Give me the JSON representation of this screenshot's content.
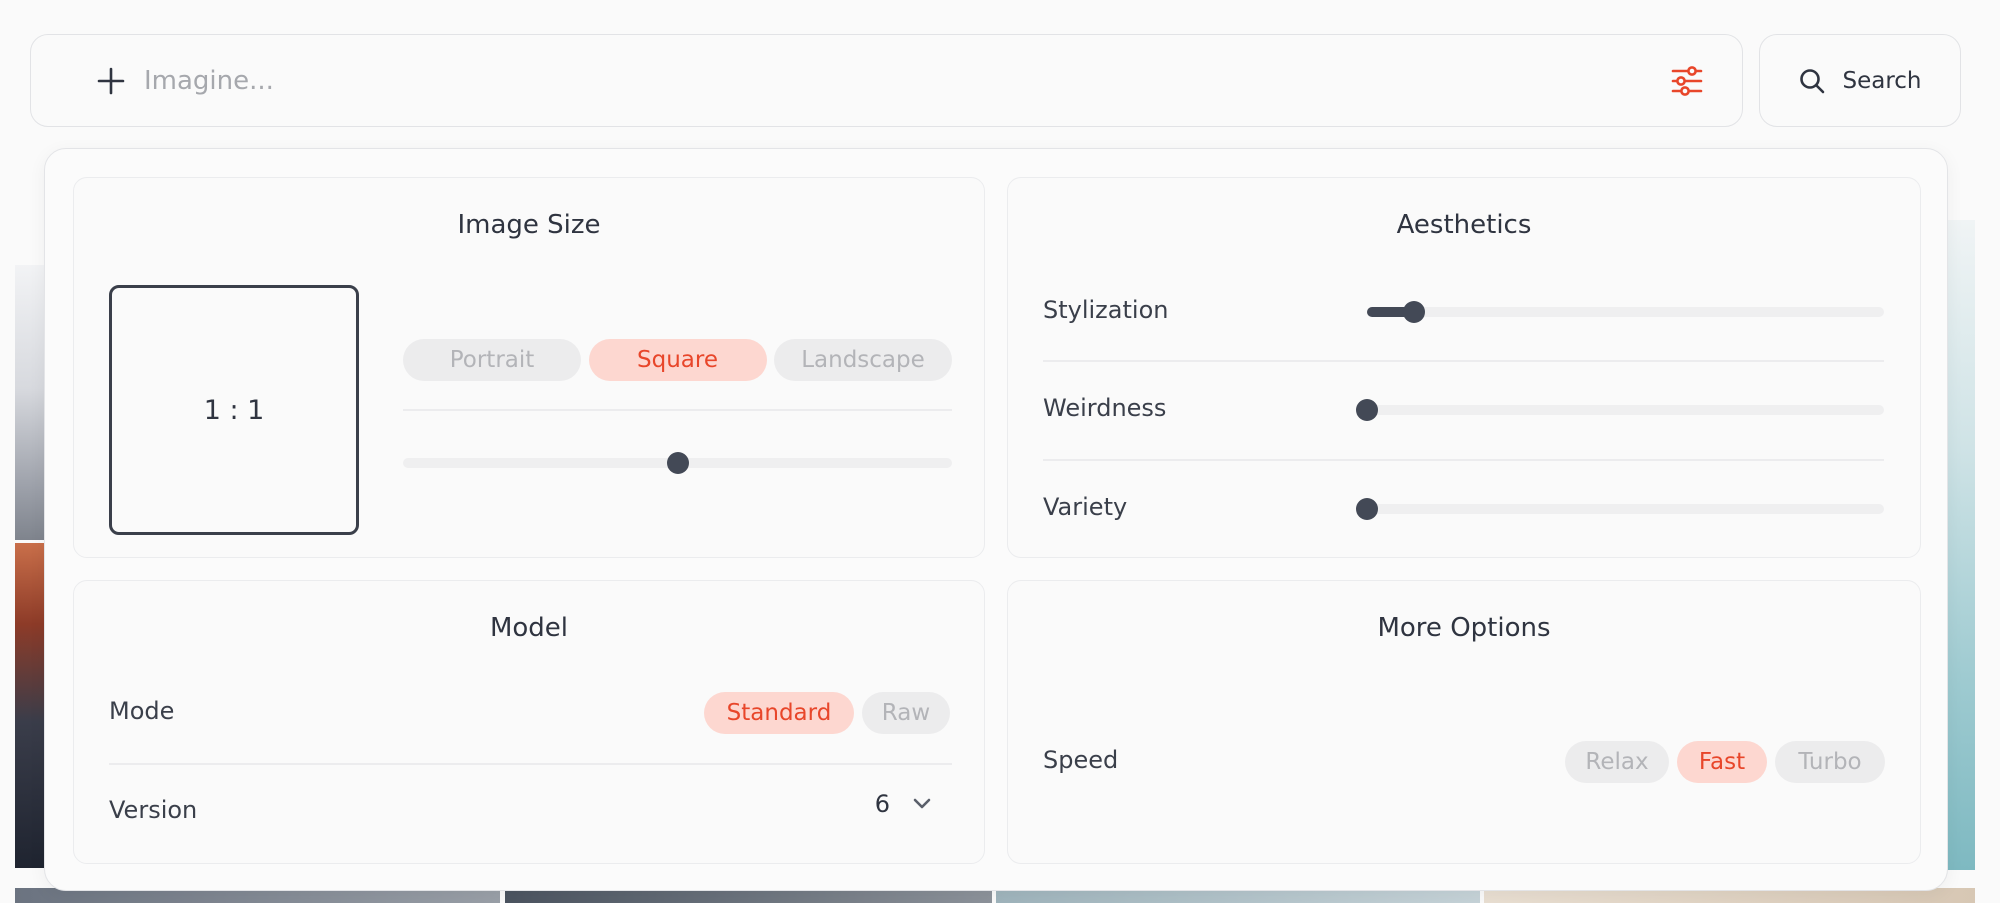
{
  "prompt": {
    "placeholder": "Imagine..."
  },
  "search": {
    "label": "Search"
  },
  "colors": {
    "accent": "#e8462a",
    "accent_soft": "#fdd7d0",
    "dark": "#434956"
  },
  "image_size": {
    "title": "Image Size",
    "ratio": "1 : 1",
    "options": [
      "Portrait",
      "Square",
      "Landscape"
    ],
    "selected": "Square",
    "slider_value": 0.5
  },
  "aesthetics": {
    "title": "Aesthetics",
    "sliders": [
      {
        "label": "Stylization",
        "value": 0.09
      },
      {
        "label": "Weirdness",
        "value": 0
      },
      {
        "label": "Variety",
        "value": 0
      }
    ]
  },
  "model": {
    "title": "Model",
    "mode_label": "Mode",
    "mode_options": [
      "Standard",
      "Raw"
    ],
    "mode_selected": "Standard",
    "version_label": "Version",
    "version_value": "6"
  },
  "more_options": {
    "title": "More Options",
    "speed_label": "Speed",
    "speed_options": [
      "Relax",
      "Fast",
      "Turbo"
    ],
    "speed_selected": "Fast"
  },
  "icons": {
    "add": "plus-icon",
    "settings": "sliders-icon",
    "search": "search-icon",
    "dropdown": "chevron-down-icon"
  }
}
